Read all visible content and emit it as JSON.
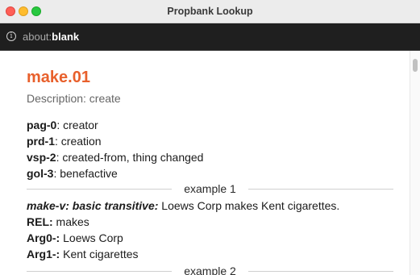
{
  "window": {
    "title": "Propbank Lookup"
  },
  "address_bar": {
    "scheme": "about:",
    "host": "blank"
  },
  "frame": {
    "name": "make.01",
    "description": "Description: create",
    "roles": [
      {
        "tag": "pag-0",
        "desc": ": creator"
      },
      {
        "tag": "prd-1",
        "desc": ": creation"
      },
      {
        "tag": "vsp-2",
        "desc": ": created-from, thing changed"
      },
      {
        "tag": "gol-3",
        "desc": ": benefactive"
      }
    ]
  },
  "examples": [
    {
      "header": "example 1",
      "name": "make-v: basic transitive:",
      "text": " Loews Corp makes Kent cigarettes.",
      "rel_label": "REL:",
      "rel_value": " makes",
      "args": [
        {
          "label": "Arg0-:",
          "value": " Loews Corp"
        },
        {
          "label": "Arg1-:",
          "value": " Kent cigarettes"
        }
      ]
    },
    {
      "header": "example 2"
    }
  ],
  "colors": {
    "accent": "#e8602c",
    "titlebar": "#ececec",
    "urlbar": "#1f1f1f",
    "close": "#ff5f57",
    "minimize": "#febc2e",
    "maximize": "#28c840"
  }
}
